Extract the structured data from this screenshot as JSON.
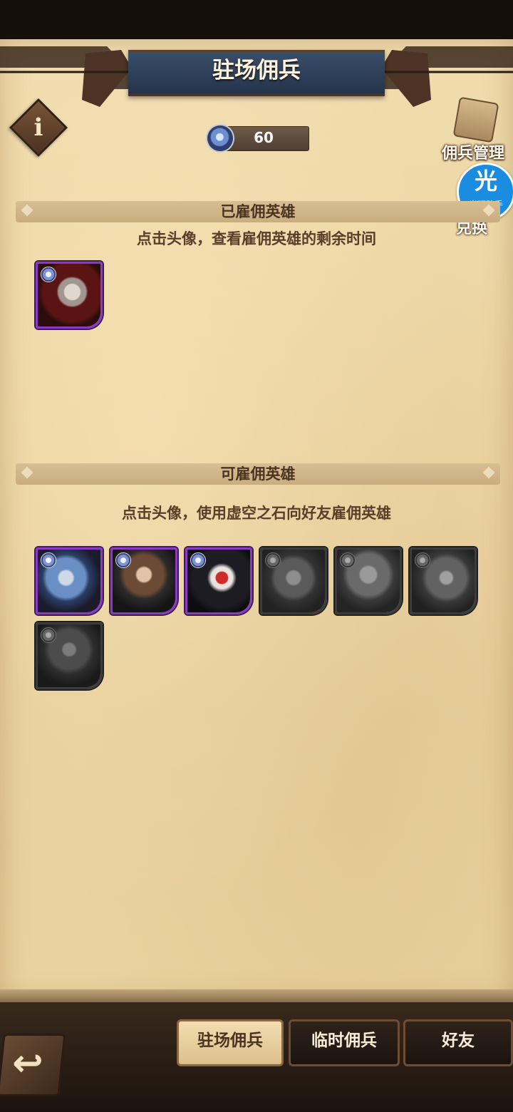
{
  "header": {
    "title": "驻场佣兵",
    "info_icon": "info-icon"
  },
  "currency": {
    "icon": "void-stone-icon",
    "value": "60"
  },
  "side_buttons": {
    "manage_label": "佣兵管理",
    "exchange_label": "兑换"
  },
  "overlay_badge": {
    "glyph": "光",
    "text": "光环助手",
    "color": "#1a8de0"
  },
  "hired_section": {
    "title": "已雇佣英雄",
    "hint": "点击头像，查看雇佣英雄的剩余时间",
    "heroes": [
      {
        "frame": "purple",
        "state": "available"
      }
    ]
  },
  "available_section": {
    "title": "可雇佣英雄",
    "hint": "点击头像，使用虚空之石向好友雇佣英雄",
    "heroes": [
      {
        "frame": "purple",
        "state": "available"
      },
      {
        "frame": "purple",
        "state": "available"
      },
      {
        "frame": "purple",
        "state": "available"
      },
      {
        "frame": "gray",
        "state": "unavailable"
      },
      {
        "frame": "gray",
        "state": "unavailable"
      },
      {
        "frame": "gray",
        "state": "unavailable"
      },
      {
        "frame": "gray",
        "state": "unavailable"
      }
    ]
  },
  "bottom_nav": {
    "back_icon": "back-arrow-icon",
    "tabs": [
      {
        "label": "驻场佣兵",
        "active": true
      },
      {
        "label": "临时佣兵",
        "active": false
      },
      {
        "label": "好友",
        "active": false
      }
    ]
  },
  "colors": {
    "rare_frame": "#8a3bc2",
    "locked_frame": "#3c3c3c",
    "title_band": "#2c3d55"
  }
}
